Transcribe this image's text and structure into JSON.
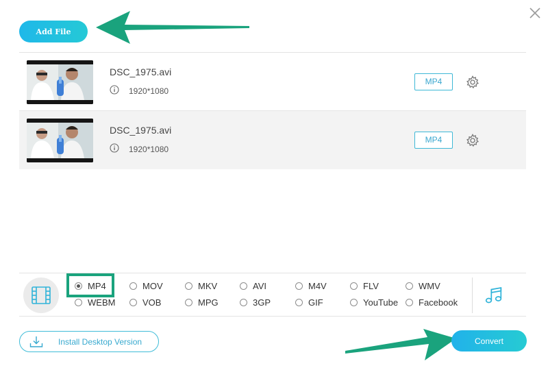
{
  "toolbar": {
    "add_file_label": "Add File"
  },
  "files": [
    {
      "name": "DSC_1975.avi",
      "resolution": "1920*1080",
      "format": "MP4"
    },
    {
      "name": "DSC_1975.avi",
      "resolution": "1920*1080",
      "format": "MP4"
    }
  ],
  "formats": {
    "selected": "MP4",
    "row1": [
      "MP4",
      "MOV",
      "MKV",
      "AVI",
      "M4V",
      "FLV",
      "WMV"
    ],
    "row2": [
      "WEBM",
      "VOB",
      "MPG",
      "3GP",
      "GIF",
      "YouTube",
      "Facebook"
    ]
  },
  "footer": {
    "install_label": "Install Desktop Version",
    "convert_label": "Convert"
  },
  "icons": {
    "close": "close-icon",
    "info": "info-icon",
    "settings": "gear-icon",
    "video": "film-icon",
    "audio": "music-note-icon",
    "download": "download-icon"
  },
  "colors": {
    "accent": "#22bde4",
    "annotation": "#1aa37d",
    "row_alt": "#f3f3f3"
  }
}
